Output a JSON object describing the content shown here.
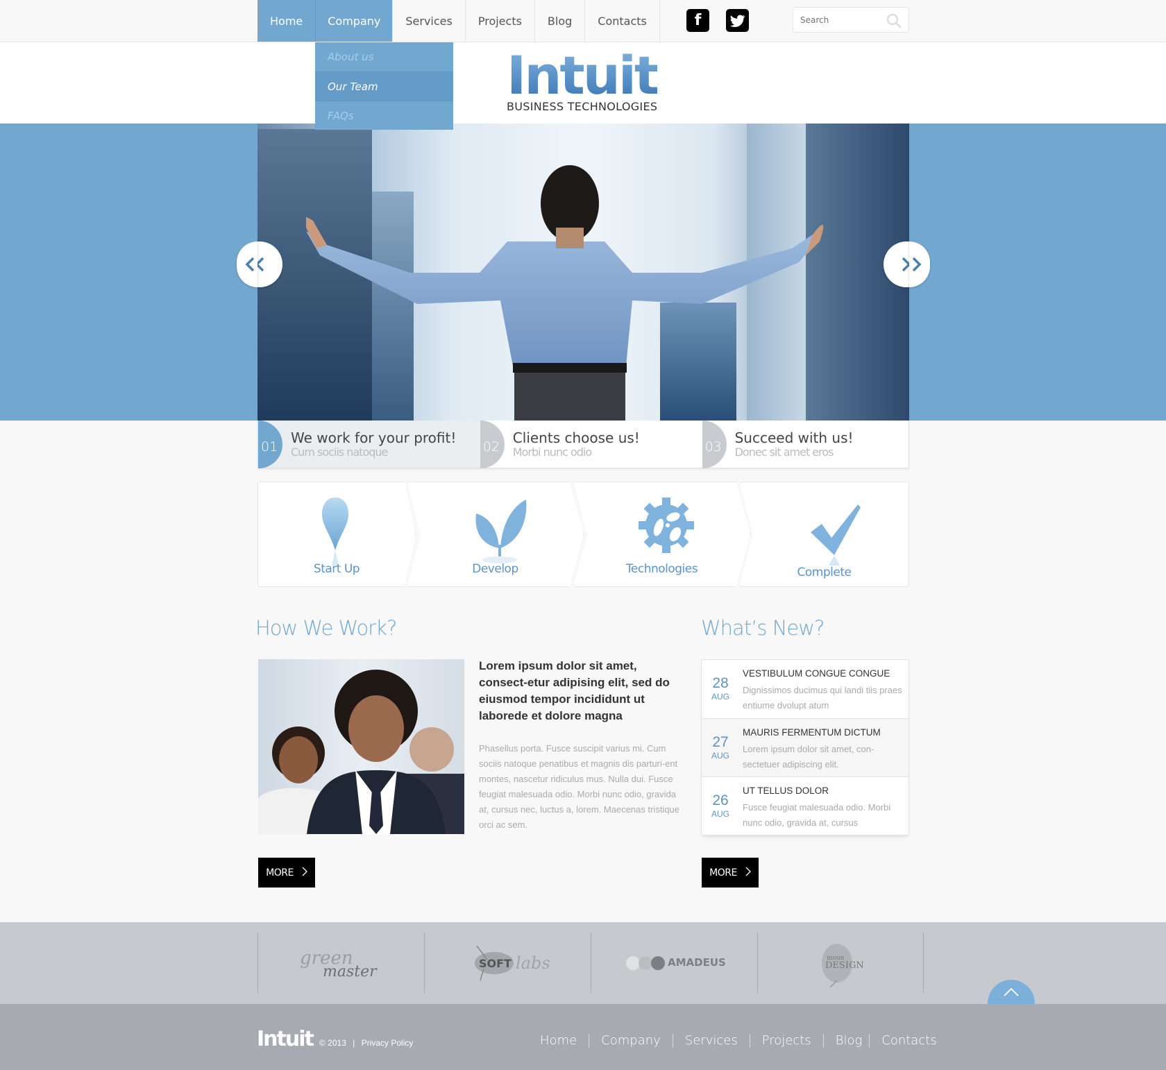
{
  "nav": {
    "items": [
      {
        "label": "Home"
      },
      {
        "label": "Company"
      },
      {
        "label": "Services"
      },
      {
        "label": "Projects"
      },
      {
        "label": "Blog"
      },
      {
        "label": "Contacts"
      }
    ],
    "active": "Home",
    "open": "Company",
    "dropdown": [
      {
        "label": "About us"
      },
      {
        "label": "Our Team"
      },
      {
        "label": "FAQs"
      }
    ],
    "dropdown_selected": "Our Team"
  },
  "social": {
    "facebook": "f",
    "twitter": "twitter-icon"
  },
  "search": {
    "placeholder": "Search"
  },
  "logo": {
    "name": "Intuit",
    "tagline": "BUSINESS TECHNOLOGIES"
  },
  "colors": {
    "accent": "#72a8d0",
    "dark": "#000000",
    "footer": "#a7aab0",
    "partners": "#c6c9ce"
  },
  "slider": {
    "prev": "‹",
    "next": "›"
  },
  "feature_tabs": [
    {
      "num": "01",
      "title": "We work for your profit!",
      "subtitle": "Cum sociis natoque"
    },
    {
      "num": "02",
      "title": "Clients choose us!",
      "subtitle": "Morbi nunc odio"
    },
    {
      "num": "03",
      "title": "Succeed with us!",
      "subtitle": "Donec sit amet eros"
    }
  ],
  "steps": [
    {
      "label": "Start Up",
      "icon": "pin-icon"
    },
    {
      "label": "Develop",
      "icon": "sprout-icon"
    },
    {
      "label": "Technologies",
      "icon": "gear-icon"
    },
    {
      "label": "Complete",
      "icon": "checkmark-icon"
    }
  ],
  "how": {
    "heading": "How We Work?",
    "lead": "Lorem ipsum dolor sit amet, consect-etur adipising elit, sed do eiusmod tempor incididunt ut laborede et dolore magna",
    "body": "Phasellus porta. Fusce suscipit varius mi. Cum sociis natoque penatibus et magnis dis parturi-ent montes, nascetur ridiculus mus. Nulla dui. Fusce feugiat malesuada odio. Morbi nunc odio, gravida at, cursus nec, luctus a, lorem. Maecenas tristique orci ac sem.",
    "more": "MORE"
  },
  "news": {
    "heading": "What’s New?",
    "items": [
      {
        "day": "28",
        "month": "AUG",
        "title": "VESTIBULUM CONGUE CONGUE",
        "desc": "Dignissimos ducimus qui landi tiis praes entiume dvolupt atum"
      },
      {
        "day": "27",
        "month": "AUG",
        "title": "MAURIS FERMENTUM DICTUM",
        "desc": " Lorem ipsum dolor sit amet, con-sectetuer adipiscing elit."
      },
      {
        "day": "26",
        "month": "AUG",
        "title": "UT TELLUS DOLOR",
        "desc": "Fusce feugiat malesuada odio. Morbi nunc odio, gravida at, cursus"
      }
    ],
    "more": "MORE"
  },
  "partners": [
    {
      "name": "green master"
    },
    {
      "name": "SOFT labs"
    },
    {
      "name": "AMADEUS"
    },
    {
      "name": "moon DESIGN"
    }
  ],
  "footer": {
    "logo": "Intuit",
    "copyright": "© 2013",
    "privacy": "Privacy Policy",
    "links": [
      {
        "label": "Home"
      },
      {
        "label": "Company"
      },
      {
        "label": "Services"
      },
      {
        "label": "Projects"
      },
      {
        "label": "Blog"
      },
      {
        "label": "Contacts"
      }
    ]
  }
}
